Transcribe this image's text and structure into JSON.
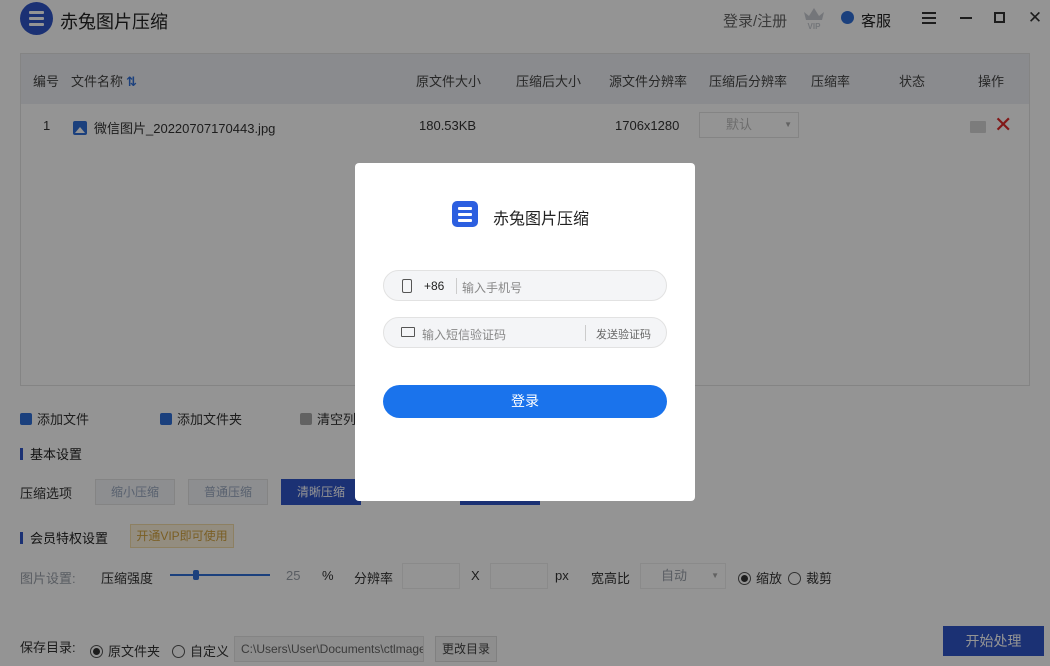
{
  "app": {
    "title": "赤兔图片压缩",
    "login_register": "登录/注册",
    "customer_service": "客服",
    "close_symbol": "✕"
  },
  "table": {
    "headers": {
      "index": "编号",
      "filename": "文件名称",
      "orig_size": "原文件大小",
      "comp_size": "压缩后大小",
      "orig_res": "源文件分辨率",
      "comp_res": "压缩后分辨率",
      "ratio": "压缩率",
      "status": "状态",
      "action": "操作"
    },
    "rows": [
      {
        "index": "1",
        "filename": "微信图片_20220707170443.jpg",
        "orig_size": "180.53KB",
        "orig_res": "1706x1280",
        "comp_res_select": "默认"
      }
    ]
  },
  "toolbar": {
    "add_file": "添加文件",
    "add_folder": "添加文件夹",
    "clear_list": "清空列"
  },
  "settings": {
    "basic_title": "基本设置",
    "compress_options_label": "压缩选项",
    "options": [
      "缩小压缩",
      "普通压缩",
      "清晰压缩"
    ],
    "active_option": "清晰压缩",
    "vip_title": "会员特权设置",
    "vip_badge": "开通VIP即可使用",
    "image_settings_label": "图片设置:",
    "strength_label": "压缩强度",
    "strength_value": "25",
    "strength_unit": "%",
    "resolution_label": "分辨率",
    "x_label": "X",
    "px_label": "px",
    "aspect_label": "宽高比",
    "aspect_value": "自动",
    "scale_label": "缩放",
    "crop_label": "裁剪"
  },
  "save": {
    "label": "保存目录:",
    "orig_folder": "原文件夹",
    "custom": "自定义",
    "path": "C:\\Users\\User\\Documents\\ctlmage",
    "change_dir": "更改目录",
    "start": "开始处理"
  },
  "modal": {
    "title": "赤兔图片压缩",
    "country_code": "+86",
    "phone_placeholder": "输入手机号",
    "code_placeholder": "输入短信验证码",
    "send_code": "发送验证码",
    "login": "登录"
  }
}
